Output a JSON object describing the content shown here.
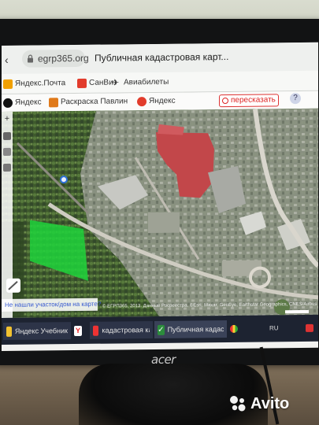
{
  "browser": {
    "url": "egrp365.org",
    "page_title": "Публичная кадастровая карт..."
  },
  "bookmarks": [
    {
      "label": "Яндекс.Почта",
      "icon": "yandex-mail-icon",
      "color": "#f0a000"
    },
    {
      "label": "СанВиз",
      "icon": "sanviz-icon",
      "color": "#e23c2c"
    },
    {
      "label": "Авиабилеты",
      "icon": "airplane-icon",
      "color": "#333333"
    },
    {
      "label": "Яндекс",
      "icon": "yandex-icon",
      "color": "#111111"
    },
    {
      "label": "Раскраска Павлин",
      "icon": "raskraska-icon",
      "color": "#e07a1a"
    },
    {
      "label": "Яндекс",
      "icon": "yandex-red-icon",
      "color": "#e23c2c"
    }
  ],
  "search": {
    "button_label": "пересказать"
  },
  "map": {
    "hint_text": "Не нашли участок/дом на карте?",
    "copyright": "© ЕГРП365, 2013. Данные Росреестра. ©Esri, Maxar, GeoEye, Earthstar Geographics, CNES/Airbus DS, USDA, AeroGRID, IGN",
    "parcel_color": "#1fd33b"
  },
  "taskbar": {
    "items": [
      {
        "label": "Яндекс Учебник",
        "icon": "yandex-uchebnik-icon"
      },
      {
        "label": "",
        "icon": "yandex-browser-icon"
      },
      {
        "label": "кадастровая карта клин...",
        "icon": "video-icon"
      },
      {
        "label": "",
        "icon": "chrome-icon"
      },
      {
        "label": "Публичная кадастровая...",
        "icon": "check-icon"
      }
    ],
    "lang": "RU"
  },
  "monitor": {
    "brand": "acer"
  },
  "watermark": {
    "text": "Avito"
  }
}
